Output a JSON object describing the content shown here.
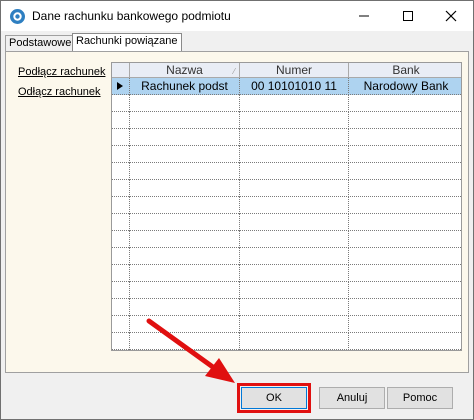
{
  "window": {
    "title": "Dane rachunku bankowego podmiotu"
  },
  "tabs": [
    {
      "label": "Podstawowe"
    },
    {
      "label": "Rachunki powiązane"
    }
  ],
  "links": {
    "connect": "Podłącz rachunek",
    "disconnect": "Odłącz rachunek"
  },
  "table": {
    "columns": [
      "Nazwa",
      "Numer",
      "Bank"
    ],
    "rows": [
      {
        "nazwa": "Rachunek podst",
        "numer": "00 10101010 11",
        "bank": "Narodowy Bank"
      }
    ]
  },
  "buttons": {
    "ok": "OK",
    "cancel": "Anuluj",
    "help": "Pomoc"
  },
  "colors": {
    "selected_row": "#aed3f0",
    "panel_bg": "#fcf8ec",
    "annotation": "#e01010"
  }
}
